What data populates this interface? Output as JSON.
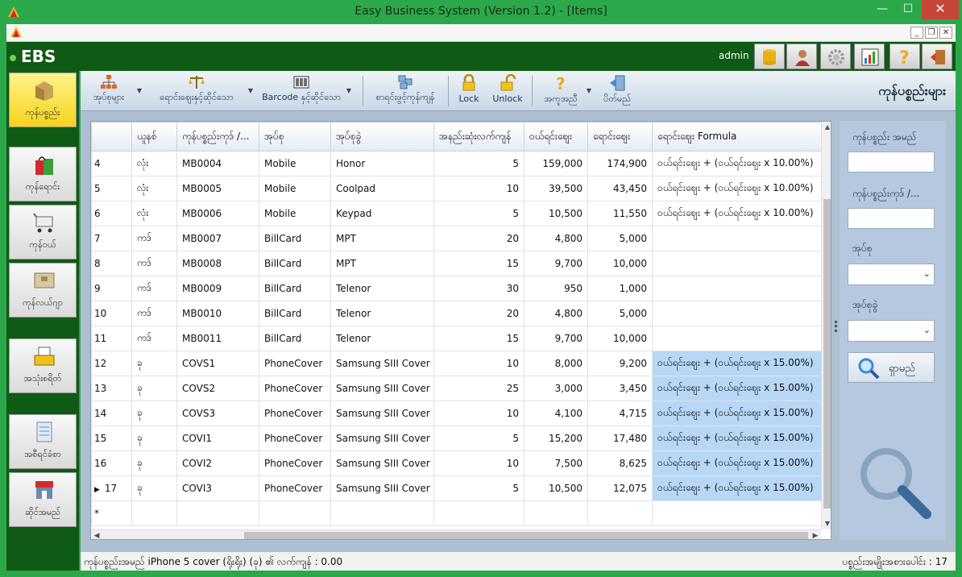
{
  "window": {
    "title": "Easy Business System  (Version 1.2) - [Items]",
    "min": "—",
    "max": "☐",
    "close": "✕"
  },
  "mdi": {
    "min": "_",
    "max": "❐",
    "close": "✕"
  },
  "header": {
    "logo": "EBS",
    "user": "admin"
  },
  "nav": {
    "items": [
      {
        "label": "ကုန်ပစ္စည်း",
        "icon": "box-icon"
      },
      {
        "label": "ကုန်ရောင်း",
        "icon": "shopping-bag-icon"
      },
      {
        "label": "ကုန်ဝယ်",
        "icon": "cart-icon"
      },
      {
        "label": "ကုန်လယ်ဂျာ",
        "icon": "ledger-icon"
      },
      {
        "label": "အသုံးစရိတ်",
        "icon": "cash-register-icon"
      },
      {
        "label": "အစီရင်ခံစာ",
        "icon": "report-icon"
      },
      {
        "label": "ဆိုင်အမည်",
        "icon": "shop-icon"
      }
    ]
  },
  "toolbar": {
    "btn1": "အုပ်စုများ",
    "btn2": "ရောင်းဈေးနှင့်ဆိုင်သော",
    "btn3": "Barcode နှင့်ဆိုင်သော",
    "btn4": "စာရင်းဖွင့်ကုန်ကျန်",
    "btn5": "Lock",
    "btn6": "Unlock",
    "btn7": "အကူအညီ",
    "btn8": "ပိတ်မည်",
    "page_title": "ကုန်ပစ္စည်းများ"
  },
  "grid": {
    "columns": [
      "",
      "ယူနစ်",
      "ကုန်ပစ္စည်းကုဒ် /...",
      "အုပ်စု",
      "အုပ်စုခွဲ",
      "အနည်းဆုံးလက်ကျန်",
      "ဝယ်ရင်းဈေး",
      "ရောင်းဈေး",
      "ရောင်းဈေး Formula"
    ],
    "rows": [
      {
        "no": "4",
        "unit": "လုံး",
        "code": "MB0004",
        "group": "Mobile",
        "sub": "Honor",
        "min": "5",
        "buy": "159,000",
        "sell": "174,900",
        "formula": "ဝယ်ရင်းဈေး + (ဝယ်ရင်းဈေး x 10.00%)",
        "hl": false
      },
      {
        "no": "5",
        "unit": "လုံး",
        "code": "MB0005",
        "group": "Mobile",
        "sub": "Coolpad",
        "min": "10",
        "buy": "39,500",
        "sell": "43,450",
        "formula": "ဝယ်ရင်းဈေး + (ဝယ်ရင်းဈေး x 10.00%)",
        "hl": false
      },
      {
        "no": "6",
        "unit": "လုံး",
        "code": "MB0006",
        "group": "Mobile",
        "sub": "Keypad",
        "min": "5",
        "buy": "10,500",
        "sell": "11,550",
        "formula": "ဝယ်ရင်းဈေး + (ဝယ်ရင်းဈေး x 10.00%)",
        "hl": false
      },
      {
        "no": "7",
        "unit": "ကဒ်",
        "code": "MB0007",
        "group": "BillCard",
        "sub": "MPT",
        "min": "20",
        "buy": "4,800",
        "sell": "5,000",
        "formula": "",
        "hl": false
      },
      {
        "no": "8",
        "unit": "ကဒ်",
        "code": "MB0008",
        "group": "BillCard",
        "sub": "MPT",
        "min": "15",
        "buy": "9,700",
        "sell": "10,000",
        "formula": "",
        "hl": false
      },
      {
        "no": "9",
        "unit": "ကဒ်",
        "code": "MB0009",
        "group": "BillCard",
        "sub": "Telenor",
        "min": "30",
        "buy": "950",
        "sell": "1,000",
        "formula": "",
        "hl": false
      },
      {
        "no": "10",
        "unit": "ကဒ်",
        "code": "MB0010",
        "group": "BillCard",
        "sub": "Telenor",
        "min": "20",
        "buy": "4,800",
        "sell": "5,000",
        "formula": "",
        "hl": false
      },
      {
        "no": "11",
        "unit": "ကဒ်",
        "code": "MB0011",
        "group": "BillCard",
        "sub": "Telenor",
        "min": "15",
        "buy": "9,700",
        "sell": "10,000",
        "formula": "",
        "hl": false
      },
      {
        "no": "12",
        "unit": "ခု",
        "code": "COVS1",
        "group": "PhoneCover",
        "sub": "Samsung SIII Cover",
        "min": "10",
        "buy": "8,000",
        "sell": "9,200",
        "formula": "ဝယ်ရင်းဈေး + (ဝယ်ရင်းဈေး x 15.00%)",
        "hl": true
      },
      {
        "no": "13",
        "unit": "ခု",
        "code": "COVS2",
        "group": "PhoneCover",
        "sub": "Samsung SIII Cover",
        "min": "25",
        "buy": "3,000",
        "sell": "3,450",
        "formula": "ဝယ်ရင်းဈေး + (ဝယ်ရင်းဈေး x 15.00%)",
        "hl": true
      },
      {
        "no": "14",
        "unit": "ခု",
        "code": "COVS3",
        "group": "PhoneCover",
        "sub": "Samsung SIII Cover",
        "min": "10",
        "buy": "4,100",
        "sell": "4,715",
        "formula": "ဝယ်ရင်းဈေး + (ဝယ်ရင်းဈေး x 15.00%)",
        "hl": true
      },
      {
        "no": "15",
        "unit": "ခု",
        "code": "COVI1",
        "group": "PhoneCover",
        "sub": "Samsung SIII Cover",
        "min": "5",
        "buy": "15,200",
        "sell": "17,480",
        "formula": "ဝယ်ရင်းဈေး + (ဝယ်ရင်းဈေး x 15.00%)",
        "hl": true
      },
      {
        "no": "16",
        "unit": "ခု",
        "code": "COVI2",
        "group": "PhoneCover",
        "sub": "Samsung SIII Cover",
        "min": "10",
        "buy": "7,500",
        "sell": "8,625",
        "formula": "ဝယ်ရင်းဈေး + (ဝယ်ရင်းဈေး x 15.00%)",
        "hl": true
      },
      {
        "no": "17",
        "unit": "ခု",
        "code": "COVI3",
        "group": "PhoneCover",
        "sub": "Samsung SIII Cover",
        "min": "5",
        "buy": "10,500",
        "sell": "12,075",
        "formula": "ဝယ်ရင်းဈေး + (ဝယ်ရင်းဈေး x 15.00%)",
        "hl": true,
        "current": true
      }
    ],
    "new_row_marker": "*",
    "current_marker": "▶"
  },
  "search": {
    "name_label": "ကုန်ပစ္စည်း အမည်",
    "name_value": "",
    "code_label": "ကုန်ပစ္စည်းကုဒ် /...",
    "code_value": "",
    "group_label": "အုပ်စု",
    "group_value": "",
    "subgroup_label": "အုပ်စုခွဲ",
    "subgroup_value": "",
    "button_label": "ရှာမည်"
  },
  "status": {
    "left": "ကုန်ပစ္စည်းအမည်  iPhone 5 cover (ရိုးရိုး) (ခု)  ၏ လက်ကျန် : 0.00",
    "right": "ပစ္စည်းအမျိုးအစားပေါင်း : 17"
  },
  "colors": {
    "accent": "#2aa84a",
    "header": "#0f5a14",
    "highlight": "#b7d7f5",
    "panel": "#aebfd2"
  }
}
